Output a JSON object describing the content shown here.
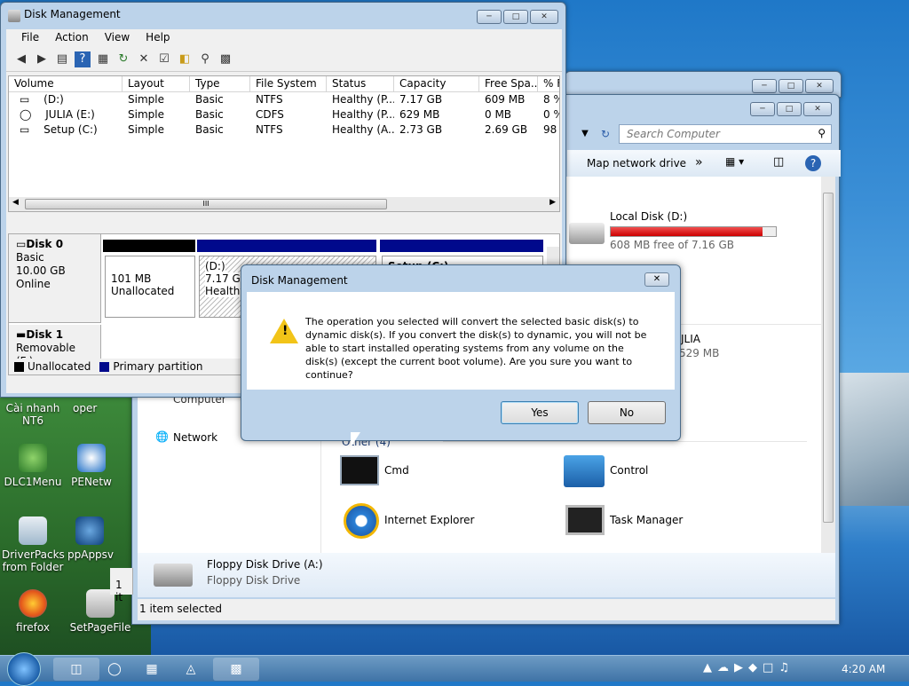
{
  "desktop": {
    "icons": [
      {
        "label": "Cài nhanh NT6",
        "x": "cai"
      },
      {
        "label": "oper"
      },
      {
        "label": "DLC1Menu"
      },
      {
        "label": "PENetw"
      },
      {
        "label": "DriverPacks from Folder"
      },
      {
        "label": "ppAppsv"
      },
      {
        "label": "firefox"
      },
      {
        "label": "SetPageFile"
      }
    ]
  },
  "dm": {
    "title": "Disk Management",
    "menu": [
      "File",
      "Action",
      "View",
      "Help"
    ],
    "columns": [
      "Volume",
      "Layout",
      "Type",
      "File System",
      "Status",
      "Capacity",
      "Free Spa...",
      "% F"
    ],
    "rows": [
      [
        "(D:)",
        "Simple",
        "Basic",
        "NTFS",
        "Healthy (P...",
        "7.17 GB",
        "609 MB",
        "8 %"
      ],
      [
        "JULIA (E:)",
        "Simple",
        "Basic",
        "CDFS",
        "Healthy (P...",
        "629 MB",
        "0 MB",
        "0 %"
      ],
      [
        "Setup (C:)",
        "Simple",
        "Basic",
        "NTFS",
        "Healthy (A...",
        "2.73 GB",
        "2.69 GB",
        "98"
      ]
    ],
    "disk0": {
      "name": "Disk 0",
      "type": "Basic",
      "size": "10.00 GB",
      "status": "Online"
    },
    "disk1": {
      "name": "Disk 1",
      "type": "Removable (F:)"
    },
    "seg1": {
      "size": "101 MB",
      "label": "Unallocated"
    },
    "seg2": {
      "name": "(D:)",
      "size": "7.17 GB",
      "status": "Healthy"
    },
    "seg3": {
      "name": "Setup (C:)"
    },
    "legend_unalloc": "Unallocated",
    "legend_primary": "Primary partition",
    "scroll_mark": "III"
  },
  "explorer": {
    "search_placeholder": "Search Computer",
    "map_drive": "Map network drive",
    "more": "»",
    "drive_d_name": "Local Disk (D:)",
    "drive_d_free": "608 MB free of 7.16 GB",
    "drive_d_used_pct": 92,
    "julia": "JLIA",
    "julia_size": "529 MB",
    "computer_cut": "Computer",
    "network": "Network",
    "other_group": "Other (4)",
    "items": [
      "Cmd",
      "Control",
      "Internet Explorer",
      "Task Manager"
    ],
    "floppy_name": "Floppy Disk Drive (A:)",
    "floppy_sub": "Floppy Disk Drive",
    "status": "1 item selected",
    "status_left": "1 it"
  },
  "dialog": {
    "title": "Disk Management",
    "message": "The operation you selected will convert the selected basic disk(s) to dynamic disk(s). If you convert the disk(s) to dynamic, you will not be able to start installed operating systems from any volume on the disk(s) (except the current boot volume). Are you sure you want to continue?",
    "yes": "Yes",
    "no": "No"
  },
  "taskbar": {
    "time": "4:20 AM"
  }
}
